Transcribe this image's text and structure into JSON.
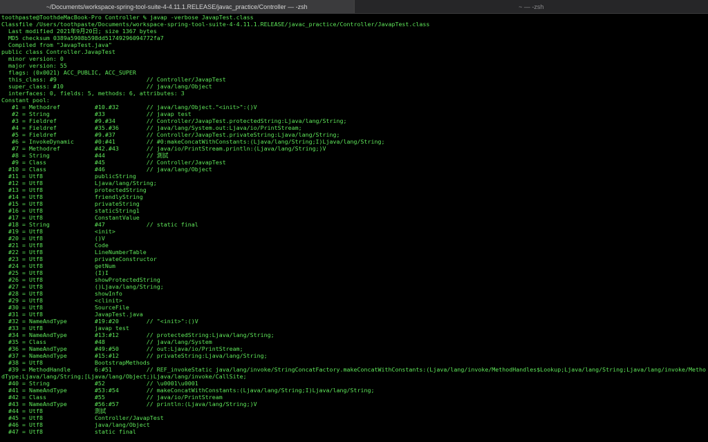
{
  "tabs": [
    {
      "title": "~/Documents/workspace-spring-tool-suite-4-4.11.1.RELEASE/javac_practice/Controller — -zsh",
      "active": true
    },
    {
      "title": "~ — -zsh",
      "active": false
    }
  ],
  "colors": {
    "text": "#5fe85a",
    "background": "#000000"
  },
  "terminal": {
    "lines": [
      "toothpaste@ToothdeMacBook-Pro Controller % javap -verbose JavapTest.class",
      "Classfile /Users/toothpaste/Documents/workspace-spring-tool-suite-4-4.11.1.RELEASE/javac_practice/Controller/JavapTest.class",
      "  Last modified 2021年9月20日; size 1367 bytes",
      "  MD5 checksum 0389a5908b598dd51749296094772fa7",
      "  Compiled from \"JavapTest.java\"",
      "public class Controller.JavapTest",
      "  minor version: 0",
      "  major version: 55",
      "  flags: (0x0021) ACC_PUBLIC, ACC_SUPER",
      "  this_class: #9                          // Controller/JavapTest",
      "  super_class: #10                        // java/lang/Object",
      "  interfaces: 0, fields: 5, methods: 6, attributes: 3",
      "Constant pool:",
      "   #1 = Methodref          #10.#32        // java/lang/Object.\"<init>\":()V",
      "   #2 = String             #33            // javap test",
      "   #3 = Fieldref           #9.#34         // Controller/JavapTest.protectedString:Ljava/lang/String;",
      "   #4 = Fieldref           #35.#36        // java/lang/System.out:Ljava/io/PrintStream;",
      "   #5 = Fieldref           #9.#37         // Controller/JavapTest.privateString:Ljava/lang/String;",
      "   #6 = InvokeDynamic      #0:#41         // #0:makeConcatWithConstants:(Ljava/lang/String;I)Ljava/lang/String;",
      "   #7 = Methodref          #42.#43        // java/io/PrintStream.println:(Ljava/lang/String;)V",
      "   #8 = String             #44            // 測試",
      "   #9 = Class              #45            // Controller/JavapTest",
      "  #10 = Class              #46            // java/lang/Object",
      "  #11 = Utf8               publicString",
      "  #12 = Utf8               Ljava/lang/String;",
      "  #13 = Utf8               protectedString",
      "  #14 = Utf8               friendlyString",
      "  #15 = Utf8               privateString",
      "  #16 = Utf8               staticString1",
      "  #17 = Utf8               ConstantValue",
      "  #18 = String             #47            // static final",
      "  #19 = Utf8               <init>",
      "  #20 = Utf8               ()V",
      "  #21 = Utf8               Code",
      "  #22 = Utf8               LineNumberTable",
      "  #23 = Utf8               privateConstructor",
      "  #24 = Utf8               getNum",
      "  #25 = Utf8               (I)I",
      "  #26 = Utf8               showProtectedString",
      "  #27 = Utf8               ()Ljava/lang/String;",
      "  #28 = Utf8               showInfo",
      "  #29 = Utf8               <clinit>",
      "  #30 = Utf8               SourceFile",
      "  #31 = Utf8               JavapTest.java",
      "  #32 = NameAndType        #19:#20        // \"<init>\":()V",
      "  #33 = Utf8               javap test",
      "  #34 = NameAndType        #13:#12        // protectedString:Ljava/lang/String;",
      "  #35 = Class              #48            // java/lang/System",
      "  #36 = NameAndType        #49:#50        // out:Ljava/io/PrintStream;",
      "  #37 = NameAndType        #15:#12        // privateString:Ljava/lang/String;",
      "  #38 = Utf8               BootstrapMethods",
      "  #39 = MethodHandle       6:#51          // REF_invokeStatic java/lang/invoke/StringConcatFactory.makeConcatWithConstants:(Ljava/lang/invoke/MethodHandles$Lookup;Ljava/lang/String;Ljava/lang/invoke/Metho",
      "dType;Ljava/lang/String;[Ljava/lang/Object;)Ljava/lang/invoke/CallSite;",
      "  #40 = String             #52            // \\u0001\\u0001",
      "  #41 = NameAndType        #53:#54        // makeConcatWithConstants:(Ljava/lang/String;I)Ljava/lang/String;",
      "  #42 = Class              #55            // java/io/PrintStream",
      "  #43 = NameAndType        #56:#57        // println:(Ljava/lang/String;)V",
      "  #44 = Utf8               測試",
      "  #45 = Utf8               Controller/JavapTest",
      "  #46 = Utf8               java/lang/Object",
      "  #47 = Utf8               static final"
    ]
  }
}
